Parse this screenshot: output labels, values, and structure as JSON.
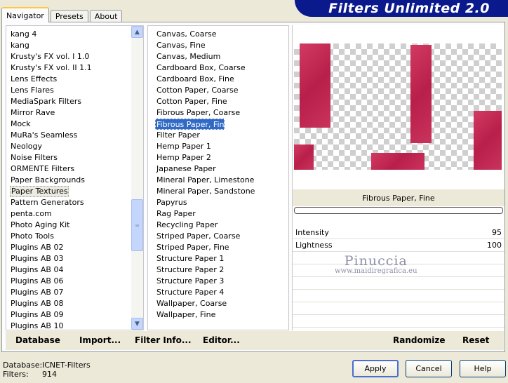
{
  "tabs": [
    {
      "label": "Navigator"
    },
    {
      "label": "Presets"
    },
    {
      "label": "About"
    }
  ],
  "banner": "Filters Unlimited 2.0",
  "categories": [
    "kang 4",
    "kang",
    "Krusty's FX vol. I 1.0",
    "Krusty's FX vol. II 1.1",
    "Lens Effects",
    "Lens Flares",
    "MediaSpark Filters",
    "Mirror Rave",
    "Mock",
    "MuRa's Seamless",
    "Neology",
    "Noise Filters",
    "ORMENTE Filters",
    "Paper Backgrounds",
    "Paper Textures",
    "Pattern Generators",
    "penta.com",
    "Photo Aging Kit",
    "Photo Tools",
    "Plugins AB 02",
    "Plugins AB 03",
    "Plugins AB 04",
    "Plugins AB 06",
    "Plugins AB 07",
    "Plugins AB 08",
    "Plugins AB 09",
    "Plugins AB 10"
  ],
  "filters": [
    "Canvas, Coarse",
    "Canvas, Fine",
    "Canvas, Medium",
    "Cardboard Box, Coarse",
    "Cardboard Box, Fine",
    "Cotton Paper, Coarse",
    "Cotton Paper, Fine",
    "Fibrous Paper, Coarse",
    "Fibrous Paper, Fine",
    "Filter Paper",
    "Hemp Paper 1",
    "Hemp Paper 2",
    "Japanese Paper",
    "Mineral Paper, Limestone",
    "Mineral Paper, Sandstone",
    "Papyrus",
    "Rag Paper",
    "Recycling Paper",
    "Striped Paper, Coarse",
    "Striped Paper, Fine",
    "Structure Paper 1",
    "Structure Paper 2",
    "Structure Paper 3",
    "Structure Paper 4",
    "Wallpaper, Coarse",
    "Wallpaper, Fine"
  ],
  "selected_filter": "Fibrous Paper, Fine",
  "params": [
    {
      "label": "Intensity",
      "value": "95"
    },
    {
      "label": "Lightness",
      "value": "100"
    }
  ],
  "watermark": {
    "name": "Pinuccia",
    "url": "www.maidiregrafica.eu"
  },
  "bottom": {
    "database": "Database",
    "import": "Import...",
    "filter_info": "Filter Info...",
    "editor": "Editor...",
    "randomize": "Randomize",
    "reset": "Reset"
  },
  "status": {
    "database_label": "Database:",
    "database_value": "ICNET-Filters",
    "filters_label": "Filters:",
    "filters_value": "914"
  },
  "buttons": {
    "apply": "Apply",
    "cancel": "Cancel",
    "help": "Help"
  },
  "colors": {
    "banner": "#0a1a8c",
    "selection": "#316ac5",
    "preview_block": "#c42a55"
  }
}
